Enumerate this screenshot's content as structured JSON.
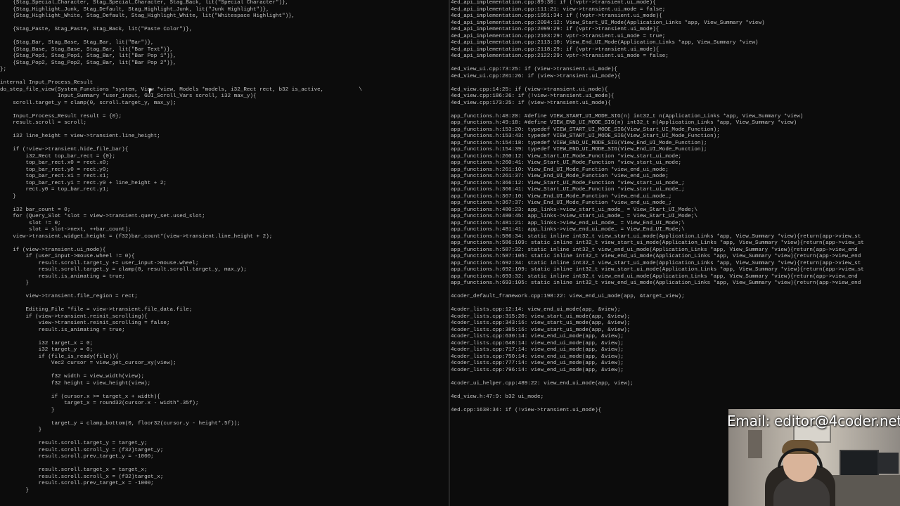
{
  "left_code": [
    "    {Stag_Special_Character, Stag_Special_Character, Stag_Back, lit(\"Special Character\")},",
    "    {Stag_Highlight_Junk, Stag_Default, Stag_Highlight_Junk, lit(\"Junk Highlight\")},",
    "    {Stag_Highlight_White, Stag_Default, Stag_Highlight_White, lit(\"Whitespace Highlight\")},",
    "",
    "    {Stag_Paste, Stag_Paste, Stag_Back, lit(\"Paste Color\")},",
    "",
    "    {Stag_Bar, Stag_Base, Stag_Bar, lit(\"Bar\")},",
    "    {Stag_Base, Stag_Base, Stag_Bar, lit(\"Bar Text\")},",
    "    {Stag_Pop1, Stag_Pop1, Stag_Bar, lit(\"Bar Pop 1\")},",
    "    {Stag_Pop2, Stag_Pop2, Stag_Bar, lit(\"Bar Pop 2\")},",
    "};",
    "",
    "internal Input_Process_Result",
    "do_step_file_view(System_Functions *system, View *view, Models *models, i32_Rect rect, b32 is_active,           \\",
    "                  Input_Summary *user_input, GUI_Scroll_Vars scroll, i32 max_y){",
    "    scroll.target_y = clamp(0, scroll.target_y, max_y);",
    "",
    "    Input_Process_Result result = {0};",
    "    result.scroll = scroll;",
    "",
    "    i32 line_height = view->transient.line_height;",
    "",
    "    if (!view->transient.hide_file_bar){",
    "        i32_Rect top_bar_rect = {0};",
    "        top_bar_rect.x0 = rect.x0;",
    "        top_bar_rect.y0 = rect.y0;",
    "        top_bar_rect.x1 = rect.x1;",
    "        top_bar_rect.y1 = rect.y0 + line_height + 2;",
    "        rect.y0 = top_bar_rect.y1;",
    "    }",
    "",
    "    i32 bar_count = 0;",
    "    for (Query_Slot *slot = view->transient.query_set.used_slot;",
    "         slot != 0;",
    "         slot = slot->next, ++bar_count);",
    "    view->transient.widget_height = (f32)bar_count*(view->transient.line_height + 2);",
    "",
    "    if (view->transient.ui_mode){",
    "        if (user_input->mouse.wheel != 0){",
    "            result.scroll.target_y += user_input->mouse.wheel;",
    "            result.scroll.target_y = clamp(0, result.scroll.target_y, max_y);",
    "            result.is_animating = true;",
    "        }",
    "",
    "        view->transient.file_region = rect;",
    "",
    "        Editing_File *file = view->transient.file_data.file;",
    "        if (view->transient.reinit_scrolling){",
    "            view->transient.reinit_scrolling = false;",
    "            result.is_animating = true;",
    "",
    "            i32 target_x = 0;",
    "            i32 target_y = 0;",
    "            if (file_is_ready(file)){",
    "                Vec2 cursor = view_get_cursor_xy(view);",
    "",
    "                f32 width = view_width(view);",
    "                f32 height = view_height(view);",
    "",
    "                if (cursor.x >= target_x + width){",
    "                    target_x = round32(cursor.x - width*.35f);",
    "                }",
    "",
    "                target_y = clamp_bottom(0, floor32(cursor.y - height*.5f));",
    "            }",
    "",
    "            result.scroll.target_y = target_y;",
    "            result.scroll.scroll_y = (f32)target_y;",
    "            result.scroll.prev_target_y = -1000;",
    "",
    "            result.scroll.target_x = target_x;",
    "            result.scroll.scroll_x = (f32)target_x;",
    "            result.scroll.prev_target_x = -1000;",
    "        }"
  ],
  "right_code": [
    "4ed_api_implementation.cpp:89:30: if (!vptr->transient.ui_mode){",
    "4ed_api_implementation.cpp:111:21: view->transient.ui_mode = false;",
    "4ed_api_implementation.cpp:1951:34: if (!vptr->transient.ui_mode){",
    "4ed_api_implementation.cpp:2094:12: View_Start_UI_Mode(Application_Links *app, View_Summary *view)",
    "4ed_api_implementation.cpp:2099:29: if (vptr->transient.ui_mode){",
    "4ed_api_implementation.cpp:2103:29: vptr->transient.ui_mode = true;",
    "4ed_api_implementation.cpp:2113:10: View_End_UI_Mode(Application_Links *app, View_Summary *view)",
    "4ed_api_implementation.cpp:2118:29: if (vptr->transient.ui_mode){",
    "4ed_api_implementation.cpp:2122:29: vptr->transient.ui_mode = false;",
    "",
    "4ed_view_ui.cpp:73:25: if (view->transient.ui_mode){",
    "4ed_view_ui.cpp:201:26: if (view->transient.ui_mode){",
    "",
    "4ed_view.cpp:14:25: if (view->transient.ui_mode){",
    "4ed_view.cpp:186:26: if (!view->transient.ui_mode){",
    "4ed_view.cpp:173:25: if (view->transient.ui_mode){",
    "",
    "app_functions.h:48:20: #define VIEW_START_UI_MODE_SIG(n) int32_t n(Application_Links *app, View_Summary *view)",
    "app_functions.h:49:18: #define VIEW_END_UI_MODE_SIG(n) int32_t n(Application_Links *app, View_Summary *view)",
    "app_functions.h:153:20: typedef VIEW_START_UI_MODE_SIG(View_Start_UI_Mode_Function);",
    "app_functions.h:153:43: typedef VIEW_START_UI_MODE_SIG(View_Start_UI_Mode_Function);",
    "app_functions.h:154:18: typedef VIEW_END_UI_MODE_SIG(View_End_UI_Mode_Function);",
    "app_functions.h:154:39: typedef VIEW_END_UI_MODE_SIG(View_End_UI_Mode_Function);",
    "app_functions.h:260:12: View_Start_UI_Mode_Function *view_start_ui_mode;",
    "app_functions.h:260:41: View_Start_UI_Mode_Function *view_start_ui_mode;",
    "app_functions.h:261:10: View_End_UI_Mode_Function *view_end_ui_mode;",
    "app_functions.h:261:37: View_End_UI_Mode_Function *view_end_ui_mode;",
    "app_functions.h:366:12: View_Start_UI_Mode_Function *view_start_ui_mode_;",
    "app_functions.h:366:41: View_Start_UI_Mode_Function *view_start_ui_mode_;",
    "app_functions.h:367:10: View_End_UI_Mode_Function *view_end_ui_mode_;",
    "app_functions.h:367:37: View_End_UI_Mode_Function *view_end_ui_mode_;",
    "app_functions.h:480:23: app_links->view_start_ui_mode_ = View_Start_UI_Mode;\\",
    "app_functions.h:480:45: app_links->view_start_ui_mode_ = View_Start_UI_Mode;\\",
    "app_functions.h:481:21: app_links->view_end_ui_mode_ = View_End_UI_Mode;\\",
    "app_functions.h:481:41: app_links->view_end_ui_mode_ = View_End_UI_Mode;\\",
    "app_functions.h:586:34: static inline int32_t view_start_ui_mode(Application_Links *app, View_Summary *view){return(app->view_st",
    "app_functions.h:586:109: static inline int32_t view_start_ui_mode(Application_Links *app, View_Summary *view){return(app->view_st",
    "app_functions.h:587:32: static inline int32_t view_end_ui_mode(Application_Links *app, View_Summary *view){return(app->view_end",
    "app_functions.h:587:105: static inline int32_t view_end_ui_mode(Application_Links *app, View_Summary *view){return(app->view_end",
    "app_functions.h:692:34: static inline int32_t view_start_ui_mode(Application_Links *app, View_Summary *view){return(app->view_st",
    "app_functions.h:692:109: static inline int32_t view_start_ui_mode(Application_Links *app, View_Summary *view){return(app->view_st",
    "app_functions.h:693:32: static inline int32_t view_end_ui_mode(Application_Links *app, View_Summary *view){return(app->view_end",
    "app_functions.h:693:105: static inline int32_t view_end_ui_mode(Application_Links *app, View_Summary *view){return(app->view_end",
    "",
    "4coder_default_framework.cpp:198:22: view_end_ui_mode(app, &target_view);",
    "",
    "4coder_lists.cpp:12:14: view_end_ui_mode(app, &view);",
    "4coder_lists.cpp:315:20: view_start_ui_mode(app, &view);",
    "4coder_lists.cpp:343:16: view_start_ui_mode(app, &view);",
    "4coder_lists.cpp:385:16: view_start_ui_mode(app, &view);",
    "4coder_lists.cpp:630:14: view_end_ui_mode(app, &view);",
    "4coder_lists.cpp:648:14: view_end_ui_mode(app, &view);",
    "4coder_lists.cpp:717:14: view_end_ui_mode(app, &view);",
    "4coder_lists.cpp:750:14: view_end_ui_mode(app, &view);",
    "4coder_lists.cpp:777:14: view_end_ui_mode(app, &view);",
    "4coder_lists.cpp:796:14: view_end_ui_mode(app, &view);",
    "",
    "4coder_ui_helper.cpp:489:22: view_end_ui_mode(app, view);",
    "",
    "4ed_view.h:47:9: b32 ui_mode;",
    "",
    "4ed.cpp:1630:34: if (!view->transient.ui_mode){"
  ],
  "overlay": {
    "email": "Email: editor@4coder.net"
  },
  "colors": {
    "background": "#0c0c0c",
    "text": "#c4c4c4",
    "overlay_text": "#ffffff"
  }
}
